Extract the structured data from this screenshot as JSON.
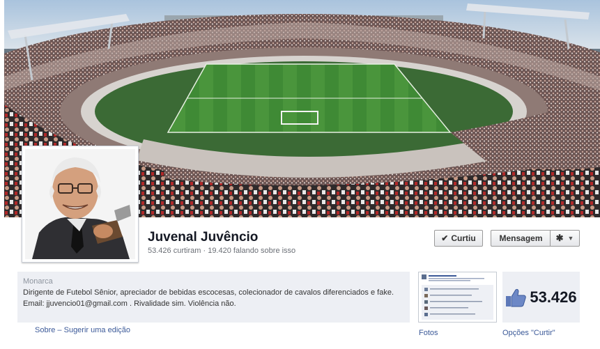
{
  "profile": {
    "name": "Juvenal Juvêncio",
    "stats": "53.426 curtiram · 19.420 falando sobre isso"
  },
  "actions": {
    "like_label": "Curtiu",
    "message_label": "Mensagem"
  },
  "about": {
    "category": "Monarca",
    "description": "Dirigente de Futebol Sênior, apreciador de bebidas escocesas, colecionador de cavalos diferenciados e fake.",
    "contact": "Email: jjuvencio01@gmail.com . Rivalidade sim. Violência não.",
    "link_about": "Sobre",
    "link_separator": "–",
    "link_suggest": "Sugerir uma edição"
  },
  "tiles": {
    "photos_label": "Fotos",
    "likes_count": "53.426",
    "likes_label": "Opções \"Curtir\""
  },
  "colors": {
    "link": "#3b5998",
    "panel": "#edeff4",
    "field": "#3f8f3a"
  },
  "icons": {
    "like_check": "check-icon",
    "settings": "gear-icon",
    "dropdown": "caret-down-icon",
    "thumbs_up": "thumbs-up-icon"
  }
}
